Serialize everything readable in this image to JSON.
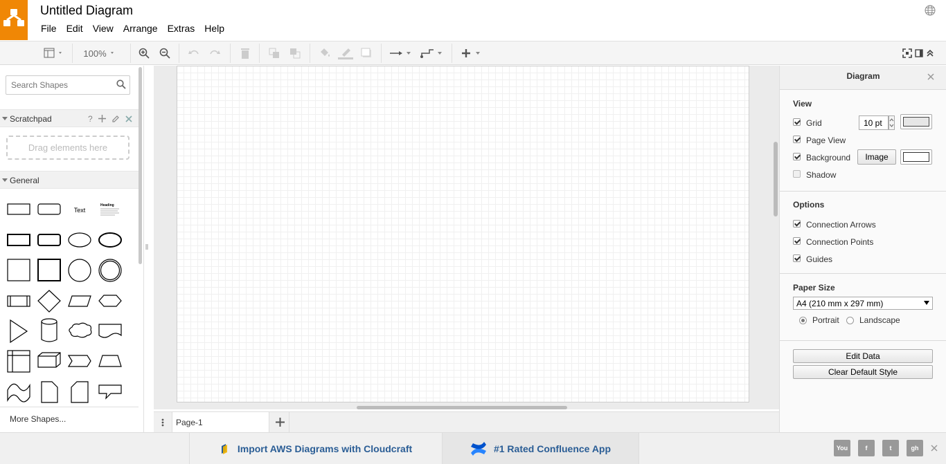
{
  "app": {
    "title": "Untitled Diagram"
  },
  "menu": [
    "File",
    "Edit",
    "View",
    "Arrange",
    "Extras",
    "Help"
  ],
  "toolbar": {
    "zoom": "100%"
  },
  "sidebar": {
    "search_placeholder": "Search Shapes",
    "scratchpad": {
      "title": "Scratchpad",
      "help": "?",
      "drop_hint": "Drag elements here"
    },
    "general": {
      "title": "General",
      "text_shape_label": "Text",
      "heading_shape_label": "Heading"
    },
    "more_shapes": "More Shapes..."
  },
  "pages": {
    "tabs": [
      "Page-1"
    ]
  },
  "format_panel": {
    "title": "Diagram",
    "view": {
      "heading": "View",
      "grid_label": "Grid",
      "grid_checked": true,
      "grid_size": "10 pt",
      "page_view_label": "Page View",
      "page_view_checked": true,
      "background_label": "Background",
      "background_checked": true,
      "image_button": "Image",
      "shadow_label": "Shadow",
      "shadow_checked": false
    },
    "options": {
      "heading": "Options",
      "connection_arrows": "Connection Arrows",
      "connection_points": "Connection Points",
      "guides": "Guides"
    },
    "paper": {
      "heading": "Paper Size",
      "size": "A4 (210 mm x 297 mm)",
      "portrait": "Portrait",
      "landscape": "Landscape",
      "orientation": "Portrait"
    },
    "buttons": {
      "edit_data": "Edit Data",
      "clear_style": "Clear Default Style"
    }
  },
  "footer": {
    "promo1": "Import AWS Diagrams with Cloudcraft",
    "promo2": "#1 Rated Confluence App",
    "social": [
      "youtube-icon",
      "facebook-icon",
      "twitter-icon",
      "github-icon"
    ]
  },
  "colors": {
    "brand": "#f08705",
    "link": "#2a5d95"
  }
}
